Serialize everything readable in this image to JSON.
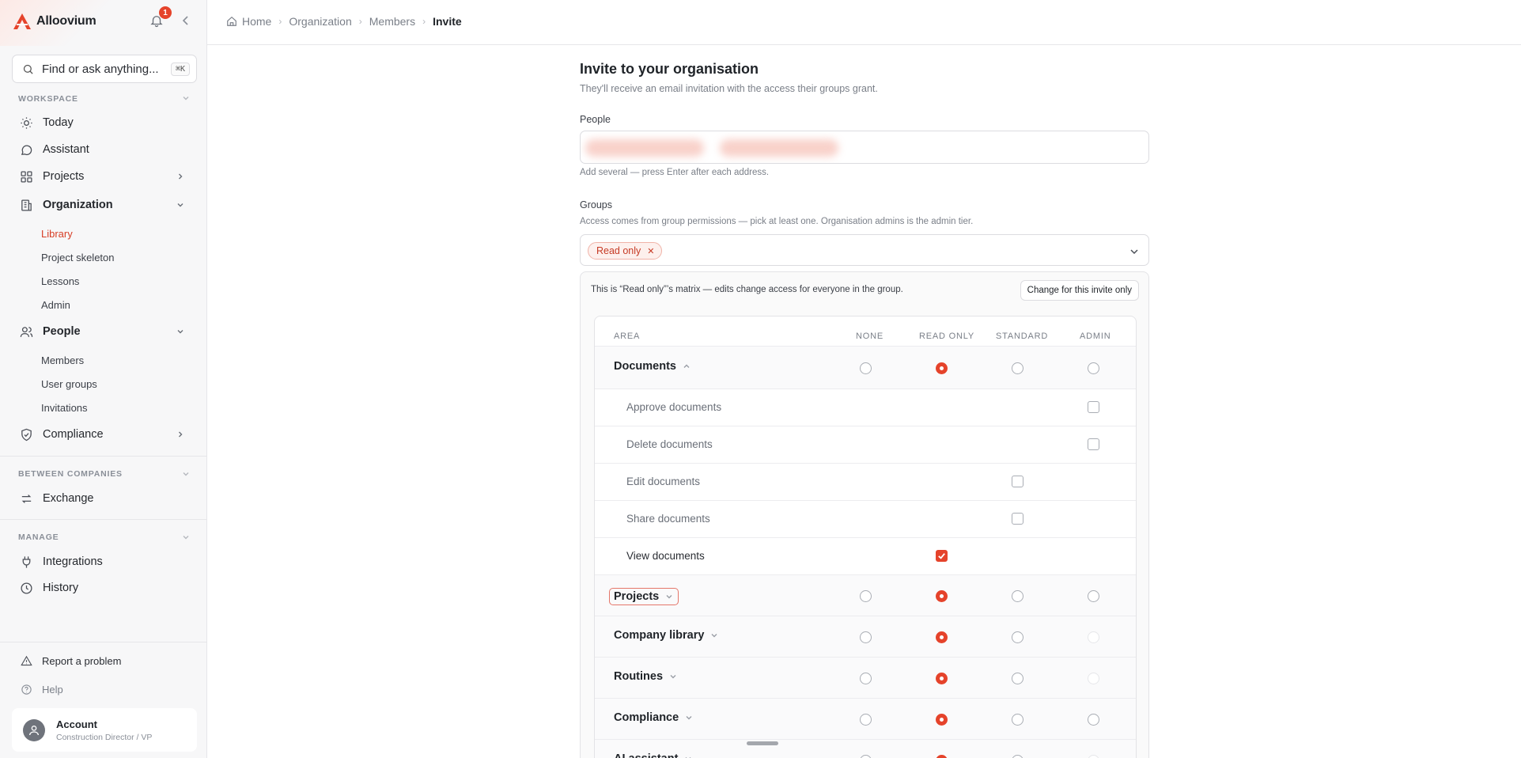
{
  "brand": {
    "name": "Alloovium",
    "accent": "#e5432b"
  },
  "notifications": {
    "count": "1"
  },
  "search": {
    "placeholder": "Find or ask anything...",
    "shortcut": "⌘K"
  },
  "sidebar": {
    "sections": {
      "workspace": "WORKSPACE",
      "between": "BETWEEN COMPANIES",
      "manage": "MANAGE"
    },
    "items": {
      "today": "Today",
      "assistant": "Assistant",
      "projects": "Projects",
      "organization": "Organization",
      "people": "People",
      "compliance": "Compliance",
      "exchange": "Exchange",
      "integrations": "Integrations",
      "history": "History"
    },
    "organization_sub": [
      "Library",
      "Project skeleton",
      "Lessons",
      "Admin"
    ],
    "people_sub": [
      "Members",
      "User groups",
      "Invitations"
    ],
    "footer": {
      "report": "Report a problem",
      "help": "Help"
    },
    "account": {
      "name": "Account",
      "role": "Construction Director / VP"
    }
  },
  "breadcrumb": [
    "Home",
    "Organization",
    "Members",
    "Invite"
  ],
  "invite": {
    "title": "Invite to your organisation",
    "subtitle": "They'll receive an email invitation with the access their groups grant.",
    "people_label": "People",
    "people_helper": "Add several — press Enter after each address.",
    "groups_label": "Groups",
    "groups_helper": "Access comes from group permissions — pick at least one. Organisation admins is the admin tier.",
    "selected_group": "Read only",
    "notice": "This is “Read only”’s matrix — edits change access for everyone in the group.",
    "change_button": "Change for this invite only"
  },
  "matrix": {
    "columns": [
      "AREA",
      "NONE",
      "READ ONLY",
      "STANDARD",
      "ADMIN"
    ],
    "documents": {
      "label": "Documents",
      "selected": "READ ONLY",
      "permissions": [
        {
          "label": "Approve documents",
          "tier": "ADMIN",
          "checked": false
        },
        {
          "label": "Delete documents",
          "tier": "ADMIN",
          "checked": false
        },
        {
          "label": "Edit documents",
          "tier": "STANDARD",
          "checked": false
        },
        {
          "label": "Share documents",
          "tier": "STANDARD",
          "checked": false
        },
        {
          "label": "View documents",
          "tier": "READ ONLY",
          "checked": true
        }
      ]
    },
    "areas": [
      {
        "label": "Projects",
        "selected": "READ ONLY",
        "admin_available": true
      },
      {
        "label": "Company library",
        "selected": "READ ONLY",
        "admin_available": false
      },
      {
        "label": "Routines",
        "selected": "READ ONLY",
        "admin_available": false
      },
      {
        "label": "Compliance",
        "selected": "READ ONLY",
        "admin_available": true
      },
      {
        "label": "AI assistant",
        "selected": "READ ONLY",
        "admin_available": false
      }
    ]
  }
}
